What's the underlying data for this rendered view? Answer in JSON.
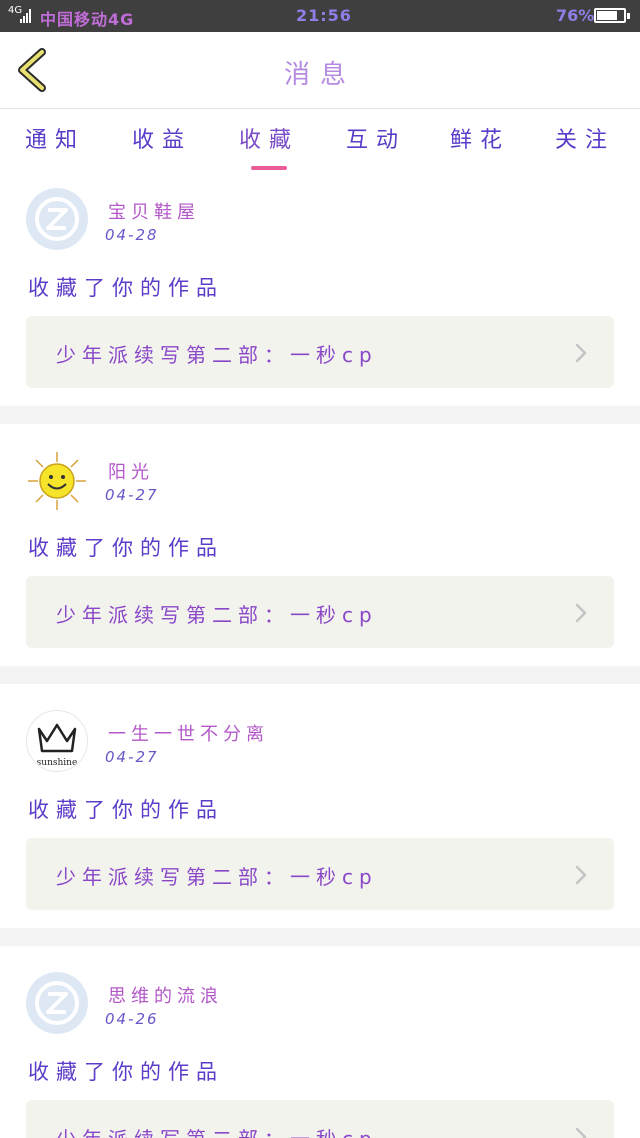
{
  "status_bar": {
    "network": "4G",
    "carrier": "中国移动4G",
    "time": "21:56",
    "battery": "76%",
    "battery_level": 0.76
  },
  "header": {
    "title": "消息"
  },
  "tabs": [
    {
      "label": "通知",
      "active": false
    },
    {
      "label": "收益",
      "active": false
    },
    {
      "label": "收藏",
      "active": true
    },
    {
      "label": "互动",
      "active": false
    },
    {
      "label": "鲜花",
      "active": false
    },
    {
      "label": "关注",
      "active": false
    }
  ],
  "messages": [
    {
      "user": "宝贝鞋屋",
      "date": "04-28",
      "action": "收藏了你的作品",
      "work": "少年派续写第二部：一秒cp",
      "avatar": "default-avatar-icon"
    },
    {
      "user": "阳光",
      "date": "04-27",
      "action": "收藏了你的作品",
      "work": "少年派续写第二部：一秒cp",
      "avatar": "sun-avatar-icon"
    },
    {
      "user": "一生一世不分离",
      "date": "04-27",
      "action": "收藏了你的作品",
      "work": "少年派续写第二部：一秒cp",
      "avatar": "crown-avatar-icon",
      "avatar_text": "sunshine"
    },
    {
      "user": "思维的流浪",
      "date": "04-26",
      "action": "收藏了你的作品",
      "work": "少年派续写第二部：一秒cp",
      "avatar": "default-avatar-icon"
    }
  ],
  "colors": {
    "tab_underline": "#e85c97",
    "card_background": "#f3f3ee",
    "status_bar": "#3f3f3f"
  }
}
